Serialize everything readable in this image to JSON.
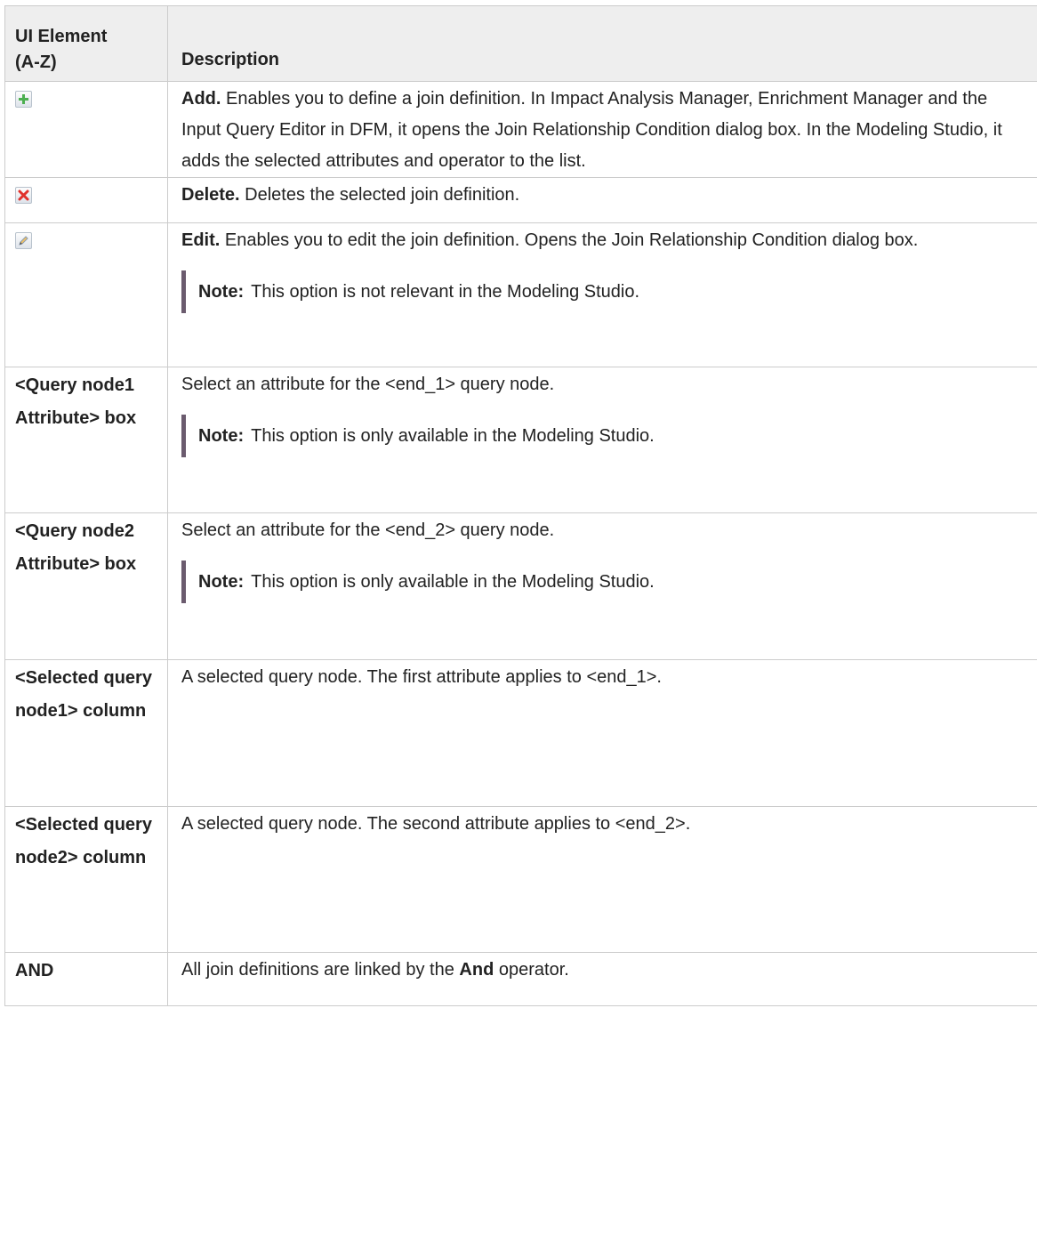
{
  "table": {
    "header": {
      "element_line1": "UI Element",
      "element_line2": "(A-Z)",
      "description": "Description"
    },
    "rows": [
      {
        "icon": "add-icon",
        "title": "Add.",
        "text": "Enables you to define a join definition. In Impact Analysis Manager, Enrichment Manager and the Input Query Editor in DFM, it opens the Join Relationship Condition dialog box. In the Modeling Studio, it adds the selected attributes and operator to the list."
      },
      {
        "icon": "delete-icon",
        "title": "Delete.",
        "text": "Deletes the selected join definition."
      },
      {
        "icon": "edit-icon",
        "title": "Edit.",
        "text": "Enables you to edit the join definition. Opens the Join Relationship Condition dialog box.",
        "note_label": "Note:",
        "note_text": "This option is not relevant in the Modeling Studio."
      },
      {
        "element": "<Query node1 Attribute> box",
        "text": "Select an attribute for the <end_1> query node.",
        "note_label": "Note:",
        "note_text": "This option is only available in the Modeling Studio."
      },
      {
        "element": "<Query node2 Attribute> box",
        "text": "Select an attribute for the <end_2> query node.",
        "note_label": "Note:",
        "note_text": "This option is only available in the Modeling Studio."
      },
      {
        "element": "<Selected query node1> column",
        "text": "A selected query node. The first attribute applies to <end_1>."
      },
      {
        "element": "<Selected query node2> column",
        "text": "A selected query node. The second attribute applies to <end_2>."
      },
      {
        "element": "AND",
        "text_before": "All join definitions are linked by the",
        "text_bold": "And",
        "text_after": "operator."
      }
    ]
  },
  "colors": {
    "header_bg": "#eeeeee",
    "border": "#cccccc",
    "note_bar": "#6b5b6e",
    "add_icon": "#4caf50",
    "delete_icon": "#e0322d",
    "edit_icon": "#8a9bb0"
  }
}
